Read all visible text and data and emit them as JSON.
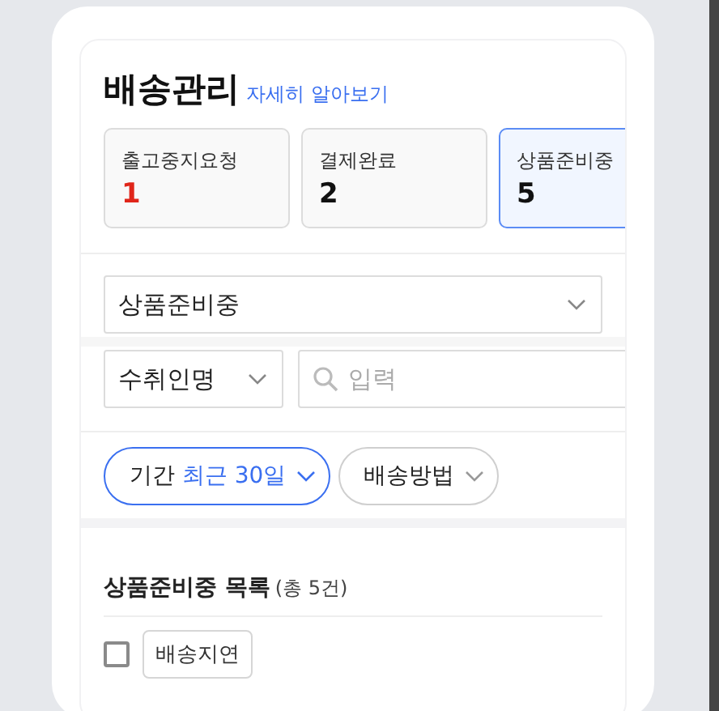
{
  "header": {
    "title": "배송관리",
    "link": "자세히 알아보기"
  },
  "status_cards": [
    {
      "label": "출고중지요청",
      "count": "1",
      "alert": true,
      "selected": false
    },
    {
      "label": "결제완료",
      "count": "2",
      "alert": false,
      "selected": false
    },
    {
      "label": "상품준비중",
      "count": "5",
      "alert": false,
      "selected": true
    }
  ],
  "status_filter": {
    "value": "상품준비중"
  },
  "search": {
    "field": "수취인명",
    "placeholder": "입력"
  },
  "chips": [
    {
      "label": "기간",
      "value": "최근 30일",
      "selected": true
    },
    {
      "label": "배송방법",
      "selected": false
    }
  ],
  "list": {
    "title": "상품준비중 목록",
    "count": "(총 5건)",
    "select_all_checked": false,
    "tag": "배송지연"
  }
}
